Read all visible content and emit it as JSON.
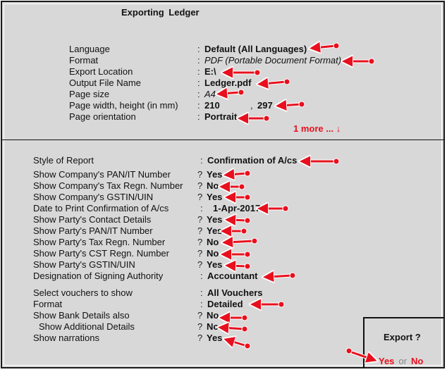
{
  "window": {
    "title": "Exporting  Ledger"
  },
  "export_settings": [
    {
      "label": "Language",
      "sep": ":",
      "value": "Default (All Languages)",
      "style": "bold"
    },
    {
      "label": "Format",
      "sep": ":",
      "value": "PDF (Portable Document Format)",
      "style": "italic"
    },
    {
      "label": "Export Location",
      "sep": ":",
      "value": "E:\\",
      "style": "bold"
    },
    {
      "label": "Output File Name",
      "sep": ":",
      "value": "Ledger.pdf",
      "style": "bold"
    },
    {
      "label": "Page size",
      "sep": ":",
      "value": "A4",
      "style": "italic"
    },
    {
      "label": "Page width, height (in mm)",
      "sep": ":",
      "value": "210",
      "value2": "297",
      "style": "bold"
    },
    {
      "label": "Page orientation",
      "sep": ":",
      "value": "Portrait",
      "style": "bold"
    }
  ],
  "page_width_sep": ",",
  "more_link": "1 more ... ↓",
  "report_settings": [
    {
      "label": "Style of Report",
      "sep": ":",
      "value": "Confirmation of A/cs"
    },
    {
      "label": "Show Company's PAN/IT Number",
      "sep": "?",
      "value": "Yes"
    },
    {
      "label": "Show Company's Tax Regn. Number",
      "sep": "?",
      "value": "No"
    },
    {
      "label": "Show Company's GSTIN/UIN",
      "sep": "?",
      "value": "Yes"
    },
    {
      "label": "Date to Print Confirmation of A/cs",
      "sep": ":",
      "value": "1-Apr-2017"
    },
    {
      "label": "Show Party's Contact Details",
      "sep": "?",
      "value": "Yes"
    },
    {
      "label": "Show Party's PAN/IT Number",
      "sep": "?",
      "value": "Yes"
    },
    {
      "label": "Show Party's Tax Regn. Number",
      "sep": "?",
      "value": "No"
    },
    {
      "label": "Show Party's CST Regn. Number",
      "sep": "?",
      "value": "No"
    },
    {
      "label": "Show Party's GSTIN/UIN",
      "sep": "?",
      "value": "Yes"
    },
    {
      "label": "Designation of Signing Authority",
      "sep": ":",
      "value": "Accountant"
    }
  ],
  "voucher_settings": [
    {
      "label": "Select vouchers to show",
      "sep": ":",
      "value": "All Vouchers"
    },
    {
      "label": "Format",
      "sep": ":",
      "value": "Detailed"
    },
    {
      "label": "Show Bank Details also",
      "sep": "?",
      "value": "No"
    },
    {
      "label": "Show Additional Details",
      "sep": "?",
      "value": "Nc"
    },
    {
      "label": "Show narrations",
      "sep": "?",
      "value": "Yes"
    }
  ],
  "export_prompt": {
    "title": "Export ?",
    "yes": "Yes",
    "or": "or",
    "no": "No"
  },
  "colors": {
    "accent": "#e8101e",
    "background": "#d8d8d8"
  }
}
